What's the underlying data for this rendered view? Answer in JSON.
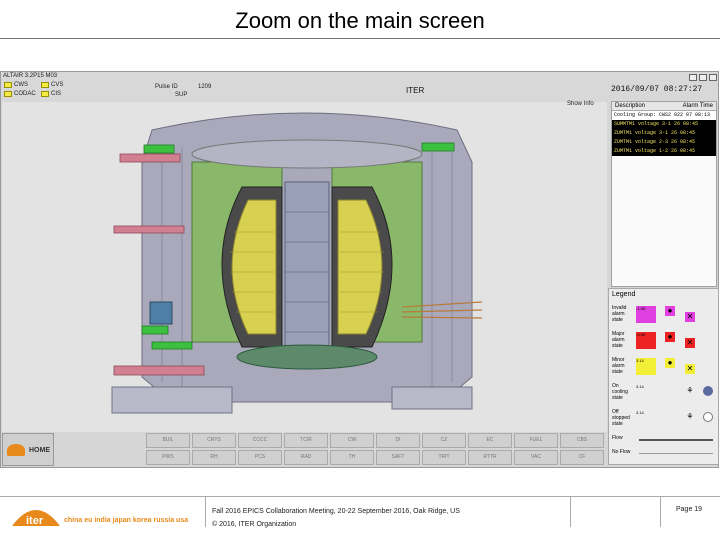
{
  "slide": {
    "title": "Zoom on the main screen",
    "footer_event": "Fall 2016 EPICS Collaboration Meeting, 20-22 September 2016, Oak Ridge, US",
    "footer_copyright": "© 2016, ITER Organization",
    "page": "Page 19",
    "logo_text": "iter",
    "countries": "china eu india japan korea russia usa"
  },
  "screen": {
    "version": "ALTAIR 3.2P15 M03",
    "alarm_chips": [
      "CWS",
      "CVS",
      "CODAC",
      "CIS"
    ],
    "pulse_label": "Pulse ID",
    "pulse_value": "1209",
    "sup_label": "SUP",
    "sup_value": "",
    "app_name": "ITER",
    "datetime": "2016/09/07 08:27:27",
    "show_info": "Show Info",
    "alarms": {
      "headers": [
        "Description",
        "Alarm Time"
      ],
      "rows": [
        {
          "desc": "Cooling Group: CWS2 022",
          "time": "07 08:13"
        },
        {
          "desc": "SUMMTM1 voltage 3-1",
          "time": "26 08:45"
        },
        {
          "desc": "ZUMTM1 voltage 3-1",
          "time": "26 08:45"
        },
        {
          "desc": "ZUMTM1 voltage 2-3",
          "time": "26 08:45"
        },
        {
          "desc": "ZUMTM1 voltage 1-2",
          "time": "26 08:45"
        }
      ]
    },
    "legend": {
      "title": "Legend",
      "rows": [
        {
          "label": "Invalid alarm state",
          "swatch_text": "-1.0E",
          "color": "#e040e0"
        },
        {
          "label": "Major alarm state",
          "swatch_text": "-0.5E",
          "color": "#ee2222"
        },
        {
          "label": "Minor alarm state",
          "swatch_text": "3.14",
          "color": "#f3ef38"
        },
        {
          "label": "On cooling state",
          "swatch_text": "3.14",
          "color": "#e0e0e0"
        },
        {
          "label": "Off stopped state",
          "swatch_text": "3.14",
          "color": "#e0e0e0"
        },
        {
          "label": "Flow",
          "swatch_text": "",
          "color": "#e0e0e0"
        },
        {
          "label": "No Flow",
          "swatch_text": "",
          "color": "#e0e0e0"
        }
      ]
    },
    "home_label": "HOME",
    "nav_buttons_row1": [
      "BUIL",
      "CRYS",
      "CCCC",
      "TCIR",
      "CW",
      "DI",
      "CZ",
      "EC",
      "FUEL",
      "CBS"
    ],
    "nav_buttons_row2": [
      "PWS",
      "RH",
      "PCS",
      "RAD",
      "TH",
      "SAFT",
      "TRIT",
      "RTTR",
      "VAC",
      "CF"
    ],
    "colors": {
      "tokamak_gray": "#a8a8b8",
      "coil_yellow": "#d8d050",
      "green_frame": "#7fb060",
      "pipe_pink": "#d08090",
      "pipe_green": "#3cc040",
      "brand_orange": "#e88a1b"
    }
  }
}
